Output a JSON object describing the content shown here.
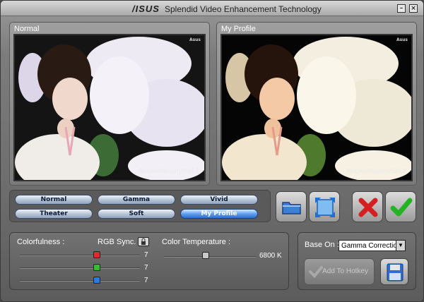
{
  "window": {
    "logo": "/ISUS",
    "title": "Splendid Video Enhancement Technology",
    "min_label": "–",
    "close_label": "×"
  },
  "previews": {
    "left_label": "Normal",
    "right_label": "My Profile",
    "watermark": "Asus",
    "signature": "RespectBeautyHall.T"
  },
  "modes": [
    "Normal",
    "Gamma",
    "Vivid",
    "Theater",
    "Soft",
    "My Profile"
  ],
  "selected_mode": "My Profile",
  "adjust": {
    "colorfulness_label": "Colorfulness :",
    "rgb_sync_label": "RGB Sync.",
    "rgb_values": [
      "7",
      "7",
      "7"
    ],
    "color_temp_label": "Color Temperature :",
    "color_temp_value": "6800 K"
  },
  "base": {
    "label": "Base On :",
    "selected": "Gamma Correction",
    "add_hotkey_label": "Add To Hotkey"
  },
  "colors": {
    "red": "#e02a2a",
    "green": "#2fbf2f",
    "blue": "#2a7ae0",
    "accent": "#2f6dcf"
  }
}
